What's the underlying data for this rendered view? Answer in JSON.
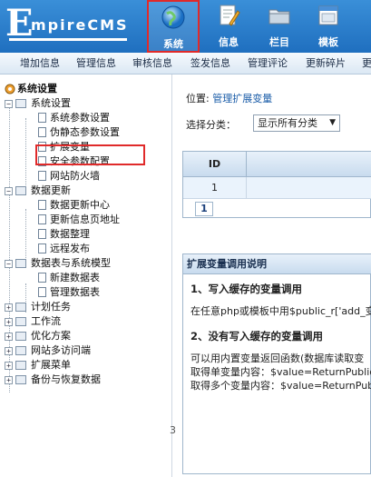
{
  "header": {
    "logo_e": "E",
    "logo_rest": "mpireCMS",
    "nav": [
      {
        "label": "系统",
        "icon": "globe-icon",
        "active": true
      },
      {
        "label": "信息",
        "icon": "document-edit-icon"
      },
      {
        "label": "栏目",
        "icon": "folder-icon"
      },
      {
        "label": "模板",
        "icon": "window-icon"
      }
    ]
  },
  "subnav": [
    "增加信息",
    "管理信息",
    "审核信息",
    "签发信息",
    "管理评论",
    "更新碎片",
    "更"
  ],
  "sidebar": {
    "root": "系统设置",
    "groups": [
      {
        "label": "系统设置",
        "expanded": true,
        "items": [
          "系统参数设置",
          "伪静态参数设置",
          "扩展变量",
          "安全参数配置",
          "网站防火墙"
        ]
      },
      {
        "label": "数据更新",
        "expanded": true,
        "items": [
          "数据更新中心",
          "更新信息页地址",
          "数据整理",
          "远程发布"
        ]
      },
      {
        "label": "数据表与系统模型",
        "expanded": true,
        "items": [
          "新建数据表",
          "管理数据表"
        ]
      },
      {
        "label": "计划任务",
        "expanded": false
      },
      {
        "label": "工作流",
        "expanded": false
      },
      {
        "label": "优化方案",
        "expanded": false
      },
      {
        "label": "网站多访问端",
        "expanded": false
      },
      {
        "label": "扩展菜单",
        "expanded": false
      },
      {
        "label": "备份与恢复数据",
        "expanded": false
      }
    ]
  },
  "main": {
    "position_label": "位置: ",
    "position_link": "管理扩展变量",
    "filter_label": "选择分类：",
    "filter_value": "显示所有分类",
    "table_header_id": "ID",
    "table_row_id": "1",
    "pager_current": "1",
    "info_title": "扩展变量调用说明",
    "info_lines": [
      {
        "text": "1、写入缓存的变量调用",
        "bold": true
      },
      {
        "text": "在任意php或模板中用$public_r['add_变",
        "bold": false
      },
      {
        "text": "2、没有写入缓存的变量调用",
        "bold": true
      },
      {
        "text": "可以用内置变量返回函数(数据库读取变",
        "bold": false
      },
      {
        "text": "取得单变量内容：$value=ReturnPublicA",
        "bold": false
      },
      {
        "text": "取得多个变量内容：$value=ReturnPub",
        "bold": false
      }
    ]
  },
  "page_number": "3",
  "colors": {
    "header": "#2a80cf",
    "highlight": "#e02a2a",
    "link": "#1a5ca8"
  }
}
